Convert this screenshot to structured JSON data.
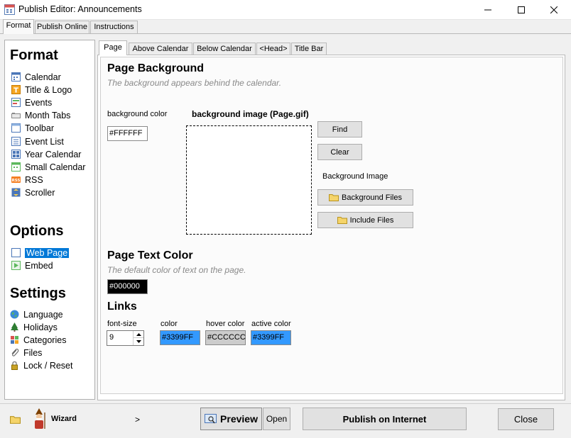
{
  "window": {
    "title": "Publish Editor: Announcements"
  },
  "top_tabs": [
    {
      "label": "Format",
      "active": true
    },
    {
      "label": "Publish Online",
      "active": false
    },
    {
      "label": "Instructions",
      "active": false
    }
  ],
  "sidebar": {
    "format_heading": "Format",
    "format_items": [
      {
        "label": "Calendar",
        "icon": "calendar-icon"
      },
      {
        "label": "Title & Logo",
        "icon": "title-logo-icon"
      },
      {
        "label": "Events",
        "icon": "events-icon"
      },
      {
        "label": "Month Tabs",
        "icon": "month-tabs-icon"
      },
      {
        "label": "Toolbar",
        "icon": "toolbar-icon"
      },
      {
        "label": "Event List",
        "icon": "event-list-icon"
      },
      {
        "label": "Year Calendar",
        "icon": "year-calendar-icon"
      },
      {
        "label": "Small Calendar",
        "icon": "small-calendar-icon"
      },
      {
        "label": "RSS",
        "icon": "rss-icon"
      },
      {
        "label": "Scroller",
        "icon": "scroller-icon"
      }
    ],
    "options_heading": "Options",
    "options_items": [
      {
        "label": "Web Page",
        "icon": "web-page-icon",
        "selected": true
      },
      {
        "label": "Embed",
        "icon": "embed-icon",
        "selected": false
      }
    ],
    "settings_heading": "Settings",
    "settings_items": [
      {
        "label": "Language",
        "icon": "globe-icon"
      },
      {
        "label": "Holidays",
        "icon": "tree-icon"
      },
      {
        "label": "Categories",
        "icon": "categories-icon"
      },
      {
        "label": "Files",
        "icon": "paperclip-icon"
      },
      {
        "label": "Lock / Reset",
        "icon": "lock-icon"
      }
    ]
  },
  "inner_tabs": [
    {
      "label": "Page",
      "active": true
    },
    {
      "label": "Above Calendar",
      "active": false
    },
    {
      "label": "Below Calendar",
      "active": false
    },
    {
      "label": "<Head>",
      "active": false
    },
    {
      "label": "Title Bar",
      "active": false
    }
  ],
  "page_background": {
    "heading": "Page Background",
    "hint": "The background appears behind the calendar.",
    "color_label": "background color",
    "color_value": "#FFFFFF",
    "image_label": "background image (Page.gif)",
    "find_label": "Find",
    "clear_label": "Clear",
    "bg_image_label": "Background Image",
    "bg_files_label": "Background Files",
    "include_files_label": "Include Files"
  },
  "page_text_color": {
    "heading": "Page Text Color",
    "hint": "The default color of text on the page.",
    "value": "#000000"
  },
  "links": {
    "heading": "Links",
    "font_size_label": "font-size",
    "font_size_value": "9",
    "color_label": "color",
    "color_value": "#3399FF",
    "hover_label": "hover color",
    "hover_value": "#CCCCCC",
    "active_label": "active color",
    "active_value": "#3399FF"
  },
  "bottom_bar": {
    "wizard_label": "Wizard",
    "arrow": ">",
    "preview_label": "Preview",
    "open_label": "Open",
    "publish_label": "Publish on Internet",
    "close_label": "Close"
  },
  "colors": {
    "selection": "#0078d7",
    "link_blue": "#3399FF",
    "hover_gray": "#CCCCCC",
    "text_black": "#000000"
  }
}
